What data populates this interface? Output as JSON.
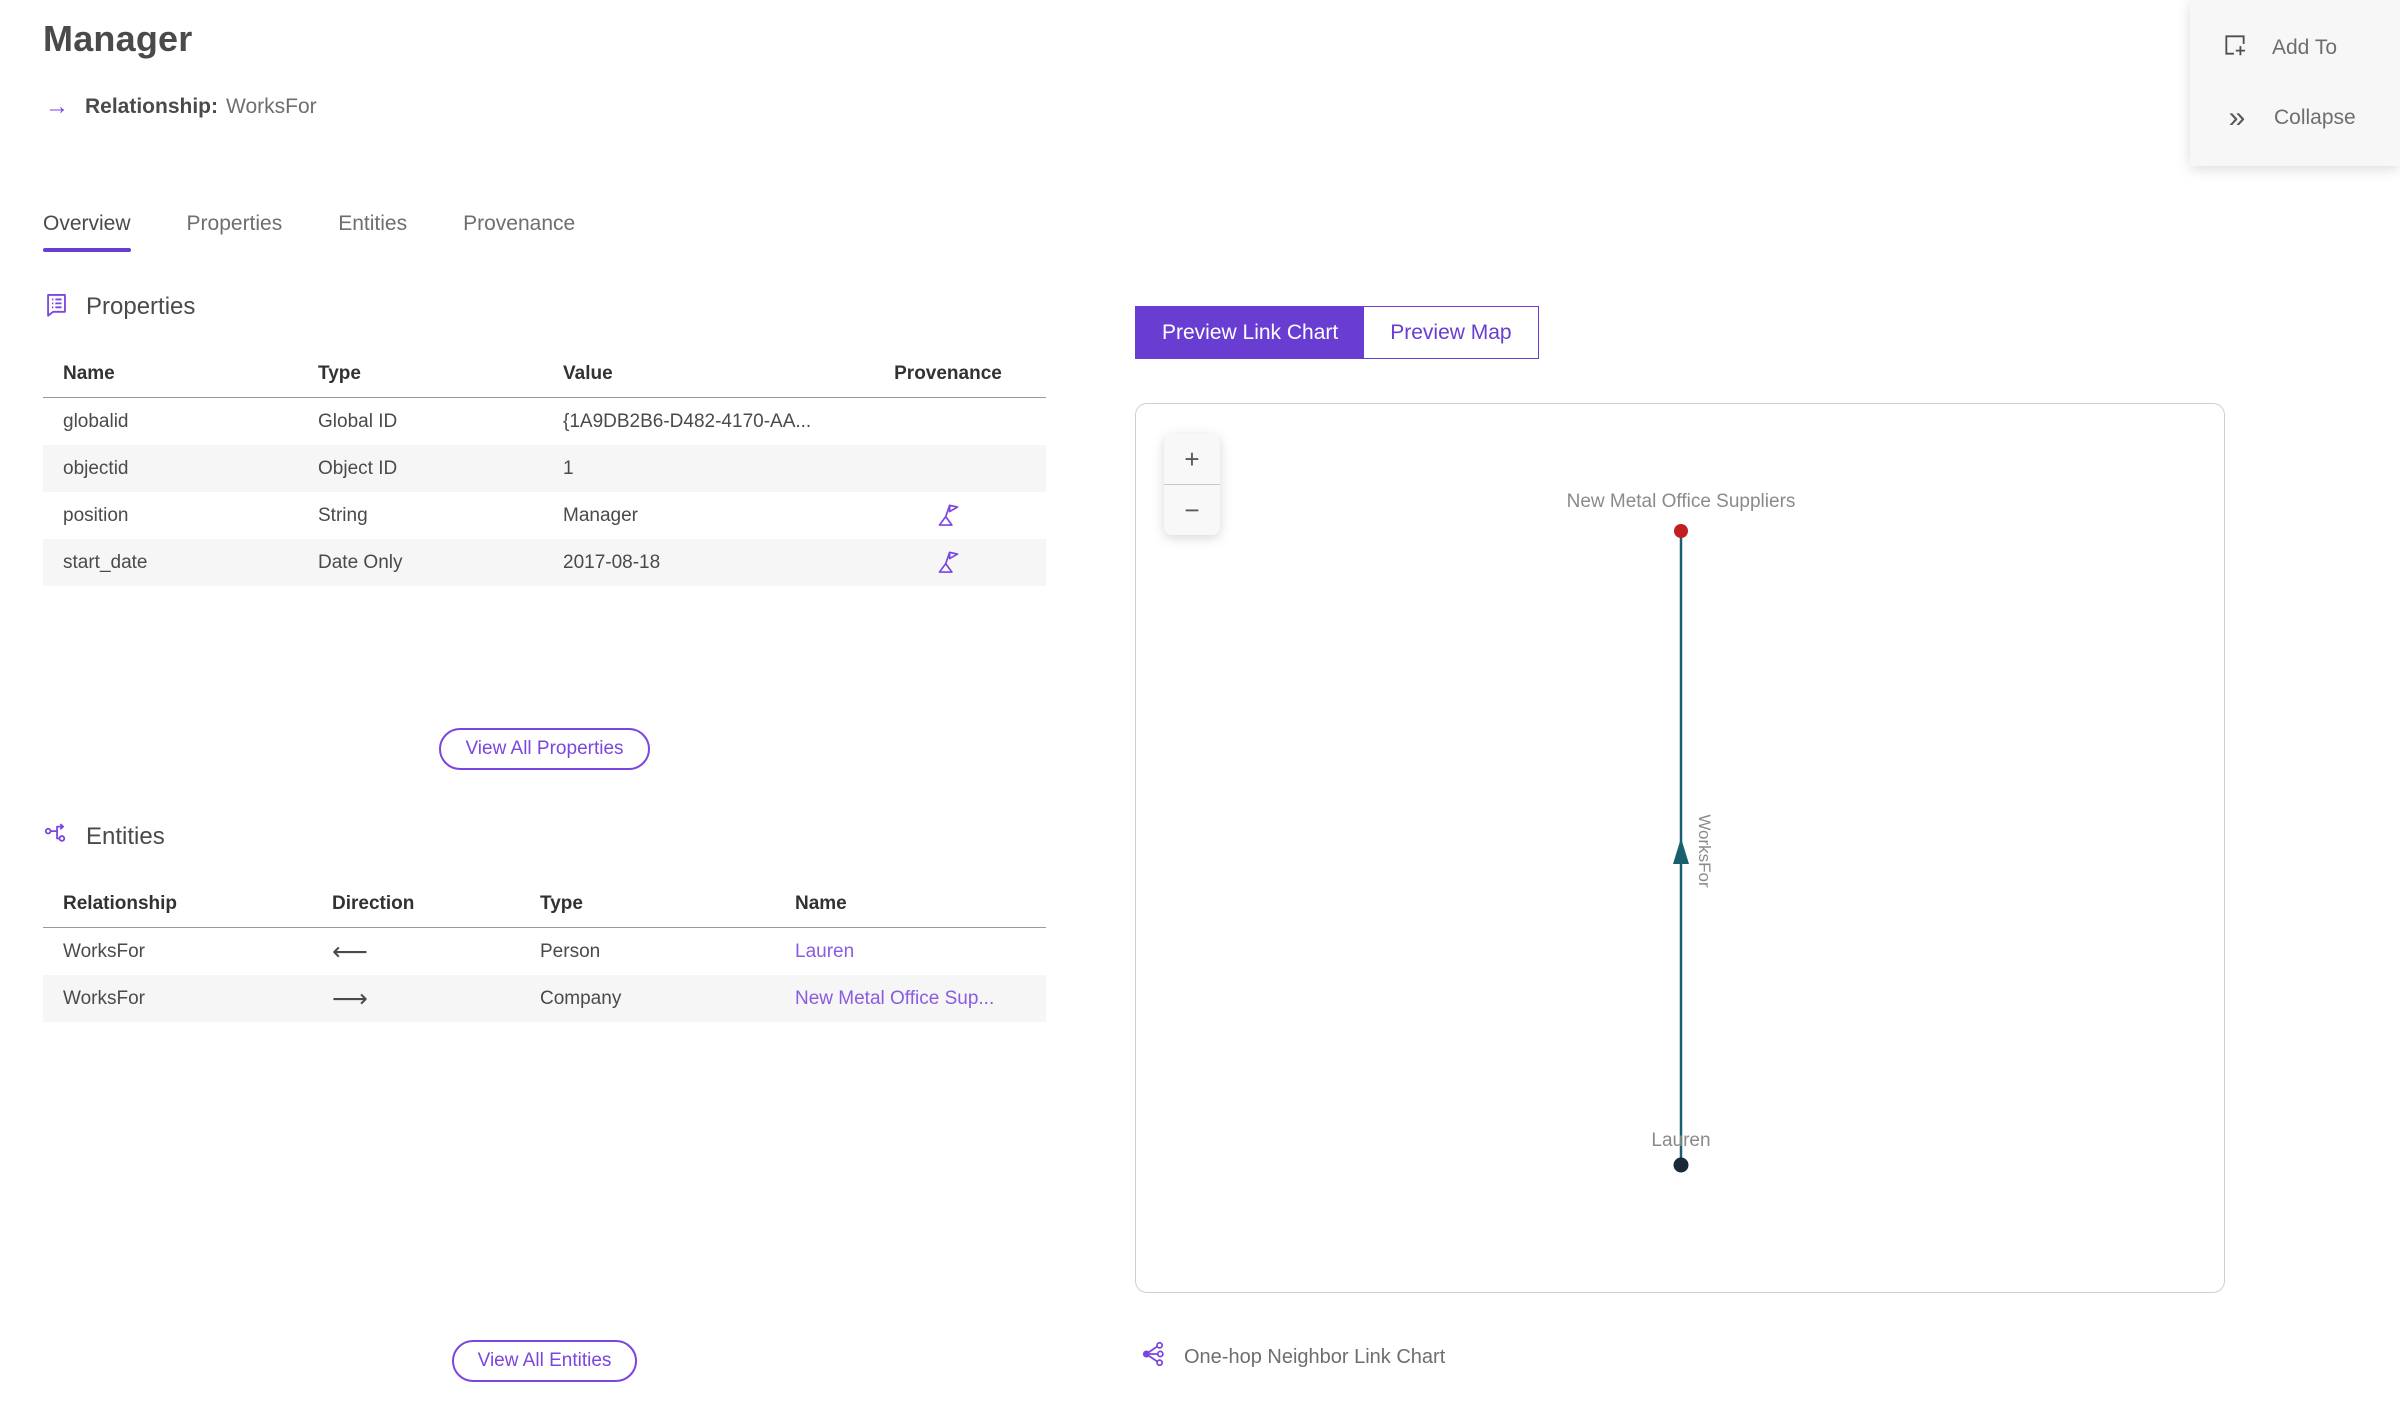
{
  "header": {
    "title": "Manager",
    "relationship_arrow": "→",
    "relationship_label": "Relationship:",
    "relationship_value": "WorksFor"
  },
  "actions": {
    "add_to_label": "Add To",
    "collapse_label": "Collapse",
    "collapse_glyph": "»"
  },
  "tabs": [
    {
      "label": "Overview",
      "active": true
    },
    {
      "label": "Properties",
      "active": false
    },
    {
      "label": "Entities",
      "active": false
    },
    {
      "label": "Provenance",
      "active": false
    }
  ],
  "properties_section": {
    "title": "Properties",
    "columns": [
      "Name",
      "Type",
      "Value",
      "Provenance"
    ],
    "rows": [
      {
        "name": "globalid",
        "type": "Global ID",
        "value": "{1A9DB2B6-D482-4170-AA...",
        "provenance": false
      },
      {
        "name": "objectid",
        "type": "Object ID",
        "value": "1",
        "provenance": false
      },
      {
        "name": "position",
        "type": "String",
        "value": "Manager",
        "provenance": true
      },
      {
        "name": "start_date",
        "type": "Date Only",
        "value": "2017-08-18",
        "provenance": true
      }
    ],
    "view_all_label": "View All Properties"
  },
  "entities_section": {
    "title": "Entities",
    "columns": [
      "Relationship",
      "Direction",
      "Type",
      "Name"
    ],
    "rows": [
      {
        "relationship": "WorksFor",
        "direction": "⟵",
        "type": "Person",
        "name": "Lauren"
      },
      {
        "relationship": "WorksFor",
        "direction": "⟶",
        "type": "Company",
        "name": "New Metal Office Sup..."
      }
    ],
    "view_all_label": "View All Entities"
  },
  "preview": {
    "link_chart_label": "Preview Link Chart",
    "map_label": "Preview Map",
    "active_segment": "Preview Link Chart",
    "zoom_in": "+",
    "zoom_out": "−",
    "caption": "One-hop Neighbor Link Chart"
  },
  "graph": {
    "top_node_label": "New Metal Office Suppliers",
    "bottom_node_label": "Lauren",
    "edge_label": "WorksFor",
    "edge_direction": "up"
  },
  "colors": {
    "accent_purple": "#693cd2",
    "link_purple": "#8a5ce0",
    "icon_purple": "#7b45e0",
    "edge_teal": "#19606f",
    "top_node_red": "#c21f1f",
    "bottom_node_navy": "#1b2836",
    "alt_row_gray": "#f6f6f6"
  }
}
